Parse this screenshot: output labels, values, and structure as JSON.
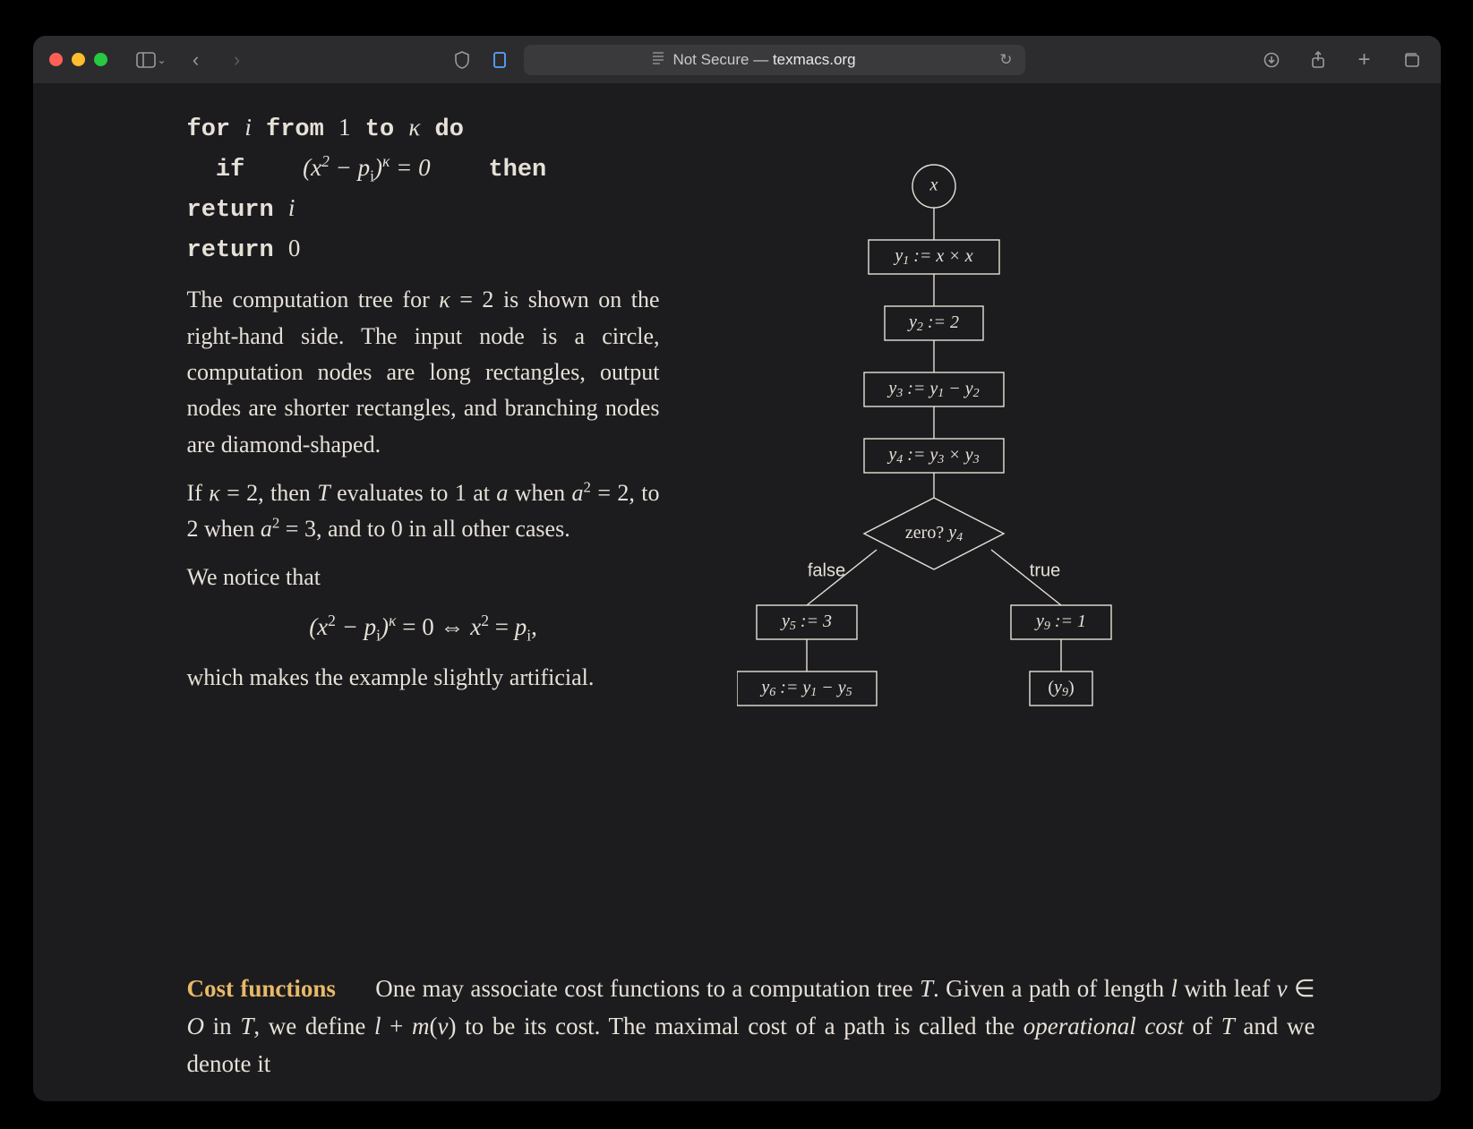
{
  "titlebar": {
    "security": "Not Secure",
    "dash": " — ",
    "domain": "texmacs.org"
  },
  "code": {
    "line1_for": "for",
    "line1_var": "i",
    "line1_from": "from",
    "line1_one": "1",
    "line1_to": "to",
    "line1_kappa": "κ",
    "line1_do": "do",
    "line2_if": "if",
    "line2_expr": "(x² − pᵢ)ᵏ = 0",
    "line2_then": "then",
    "line3_return": "return",
    "line3_var": "i",
    "line4_return": "return",
    "line4_zero": "0"
  },
  "para1": "The computation tree for κ = 2 is shown on the right-hand side. The input node is a circle, computation nodes are long rectangles, output nodes are shorter rectangles, and branching nodes are diamond-shaped.",
  "para2": "If κ = 2, then T evaluates to 1 at a when a² = 2, to 2 when a² = 3, and to 0 in all other cases.",
  "para3": "We notice that",
  "math_display": "(x² − pᵢ)ᵏ = 0 ⇔ x² = pᵢ,",
  "para4": "which makes the example slightly artificial.",
  "section": {
    "head": "Cost functions",
    "body": "One may associate cost functions to a computation tree T. Given a path of length l with leaf v ∈ O in T, we define l + m(v) to be its cost. The maximal cost of a path is called the operational cost of T and we denote it"
  },
  "diagram": {
    "input": "x",
    "n1": "y₁ := x × x",
    "n2": "y₂ := 2",
    "n3": "y₃ := y₁ − y₂",
    "n4": "y₄ := y₃ × y₃",
    "branch": "zero? y₄",
    "false": "false",
    "true": "true",
    "n5": "y₅ := 3",
    "n9": "y₉ := 1",
    "n6": "y₆ := y₁ − y₅",
    "out9": "(y₉)"
  }
}
